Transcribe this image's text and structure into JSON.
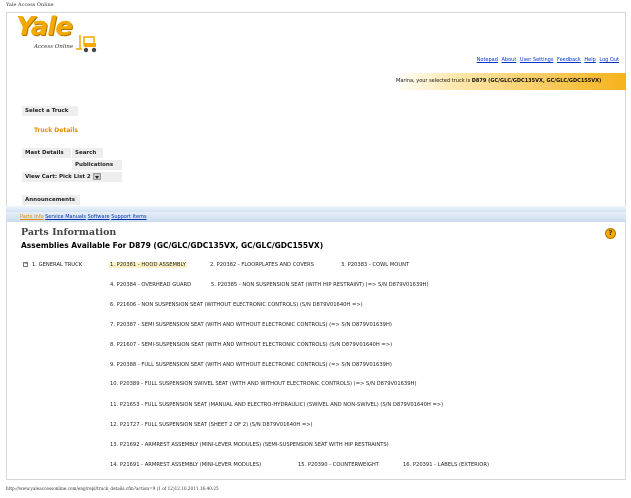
{
  "print_header": "Yale Access Online",
  "print_footer": "http://www.yaleaccessonline.com/eng/repl/truck_details.cfm?action=9 (1 of 12)12.10.2011 16:40:25",
  "brand": {
    "logo_text": "Yale",
    "tagline": "Access Online"
  },
  "top_links": [
    "Notepad",
    "About",
    "User Settings",
    "Feedback",
    "Help",
    "Log Out"
  ],
  "truck_bar": {
    "prefix": "Marina, your selected truck is",
    "truck": "D879 (GC/GLC/GDC135VX, GC/GLC/GDC155VX)"
  },
  "nav": {
    "select_truck": "Select a Truck",
    "truck_details": "Truck Details",
    "mast_details": "Mast Details",
    "search": "Search",
    "publications": "Publications",
    "view_cart": "View Cart: Pick List 2",
    "announcements": "Announcements"
  },
  "subnav": [
    "Parts Info",
    "Service Manuals",
    "Software",
    "Support Items"
  ],
  "main": {
    "section_title": "Parts Information",
    "assemblies_title": "Assemblies Available For D879 (GC/GLC/GDC135VX, GC/GLC/GDC155VX)",
    "group_label": "1. GENERAL TRUCK",
    "help_icon": "?",
    "expand_icon": "−"
  },
  "assemblies": [
    "1. P20381 - HOOD ASSEMBLY",
    "2. P20382 - FLOORPLATES AND COVERS",
    "3. P20383 - COWL MOUNT",
    "4. P20384 - OVERHEAD GUARD",
    "5. P20385 - NON SUSPENSION SEAT (WITH HIP RESTRAINT) (=> S/N D879V01639H)",
    "6. P21606 - NON SUSPENSION SEAT (WITHOUT ELECTRONIC CONTROLS) (S/N D879V01640H =>)",
    "7. P20387 - SEMI SUSPENSION SEAT (WITH AND WITHOUT ELECTRONIC CONTROLS) (=> S/N D879V01639H)",
    "8. P21607 - SEMI-SUSPENSION SEAT (WITH AND WITHOUT ELECTRONIC CONTROLS) (S/N D879V01640H =>)",
    "9. P20388 - FULL SUSPENSION SEAT (WITH AND WITHOUT ELECTRONIC CONTROLS) (=> S/N D879V01639H)",
    "10. P20389 - FULL SUSPENSION SWIVEL SEAT (WITH AND WITHOUT ELECTRONIC CONTROLS) (=> S/N D879V01639H)",
    "11. P21653 - FULL SUSPENSION SEAT (MANUAL AND ELECTRO-HYDRAULIC) (SWIVEL AND NON-SWIVEL) (S/N D879V01640H =>)",
    "12. P21727 - FULL SUSPENSION SEAT (SHEET 2 OF 2) (S/N D879V01640H =>)",
    "13. P21692 - ARMREST ASSEMBLY (MINI-LEVER MODULES) (SEMI-SUSPENSION SEAT WITH HIP RESTRAINTS)",
    "14. P21691 - ARMREST ASSEMBLY (MINI-LEVER MODULES)",
    "15. P20390 - COUNTERWEIGHT",
    "16. P20391 - LABELS (EXTERIOR)"
  ],
  "colors": {
    "brand_yellow": "#f5a800",
    "link_blue": "#0033cc",
    "active_orange": "#e68a00",
    "highlight": "#fcf1c4"
  },
  "icons": [
    "forklift-logo-icon",
    "help-icon",
    "dropdown-arrow-icon",
    "collapse-icon"
  ]
}
